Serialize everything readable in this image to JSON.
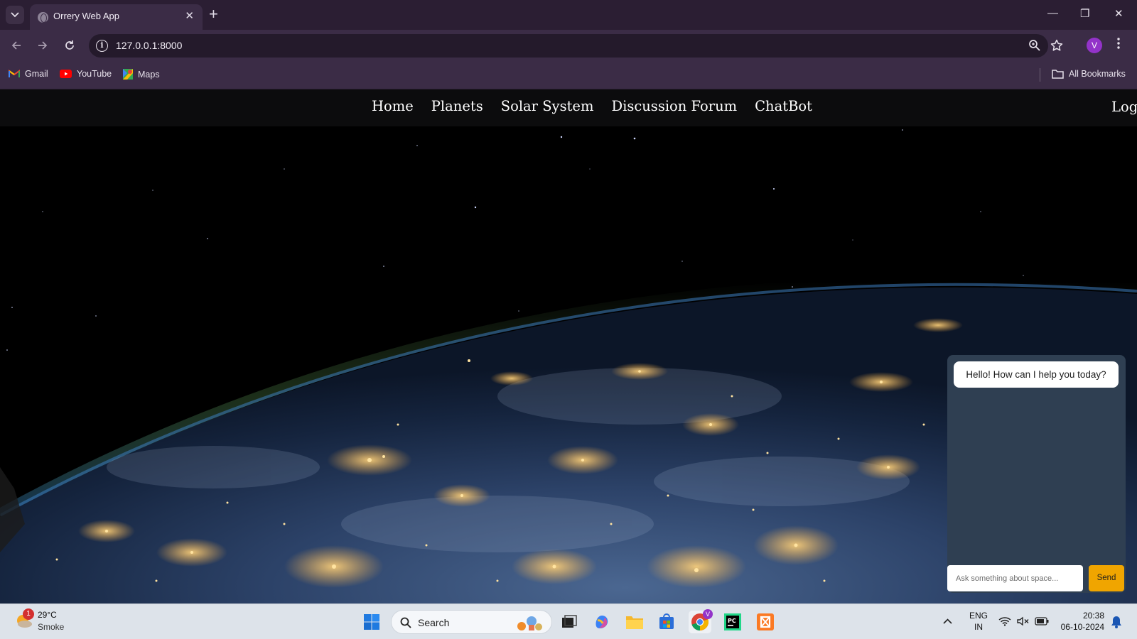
{
  "browser": {
    "tab_title": "Orrery Web App",
    "url": "127.0.0.1:8000",
    "profile_initial": "V",
    "bookmarks": [
      {
        "label": "Gmail",
        "icon": "gmail-icon"
      },
      {
        "label": "YouTube",
        "icon": "youtube-icon"
      },
      {
        "label": "Maps",
        "icon": "maps-icon"
      }
    ],
    "all_bookmarks_label": "All Bookmarks"
  },
  "site": {
    "nav_links": [
      "Home",
      "Planets",
      "Solar System",
      "Discussion Forum",
      "ChatBot"
    ],
    "login_label": "Log"
  },
  "chatbot": {
    "greeting": "Hello! How can I help you today?",
    "input_placeholder": "Ask something about space...",
    "send_label": "Send"
  },
  "taskbar": {
    "weather_badge": "1",
    "weather_temp": "29°C",
    "weather_condition": "Smoke",
    "search_label": "Search",
    "lang_line1": "ENG",
    "lang_line2": "IN",
    "time": "20:38",
    "date": "06-10-2024",
    "chrome_badge": "V"
  },
  "colors": {
    "browser_frame": "#2b1e33",
    "browser_toolbar": "#3b2c46",
    "site_nav": "#0c0c0d",
    "chat_panel": "#2f3f52",
    "send_button": "#f0a500",
    "taskbar": "#dde3ea"
  }
}
